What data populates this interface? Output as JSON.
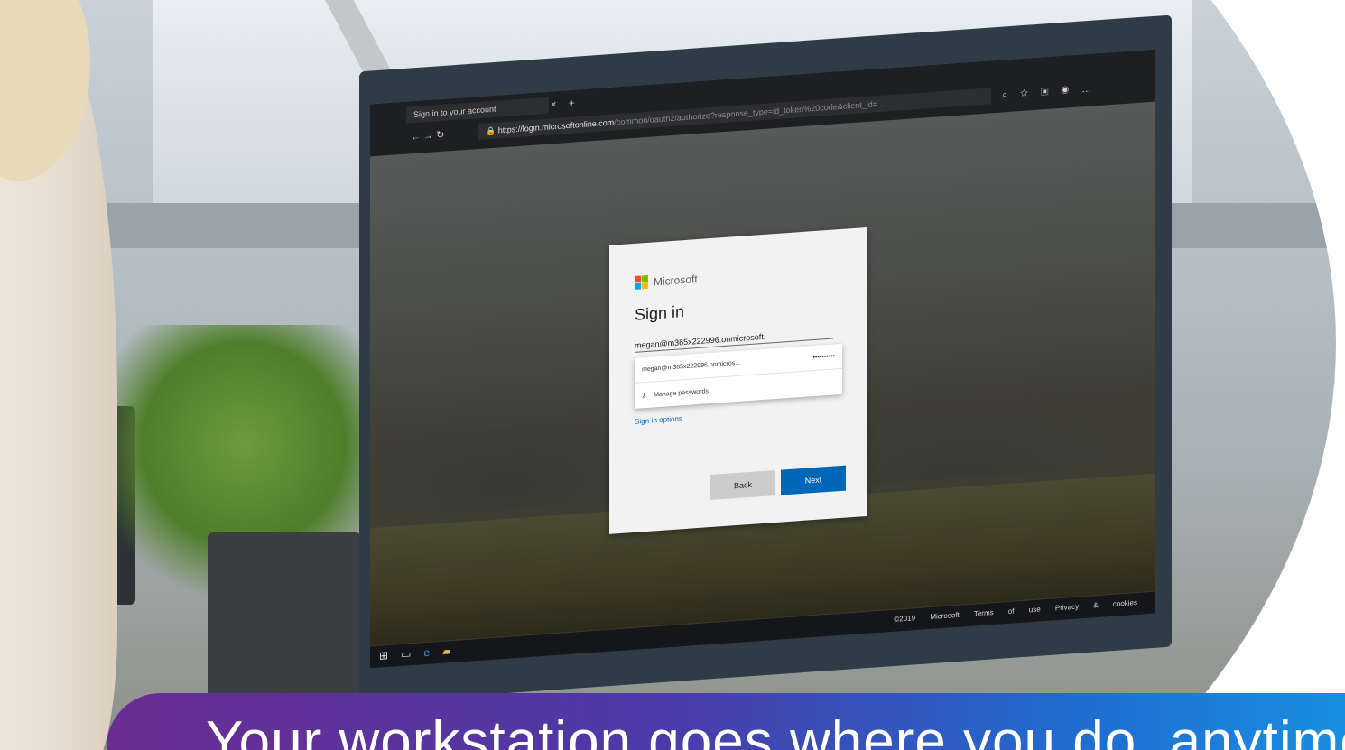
{
  "browser": {
    "tab_title": "Sign in to your account",
    "tab_close": "×",
    "tab_new": "+",
    "url_host": "https://login.microsoftonline.com",
    "url_path": "/common/oauth2/authorize?response_type=id_token%20code&client_id=..."
  },
  "signin": {
    "brand": "Microsoft",
    "title": "Sign in",
    "email_value": "megan@m365x222996.onmicrosoft.",
    "autofill_account": "megan@m365x222996.onmicros...",
    "autofill_password": "••••••••••",
    "manage_passwords": "Manage passwords",
    "options_link": "Sign-in options",
    "back_label": "Back",
    "next_label": "Next"
  },
  "taskbar": {
    "footer_links": "©2019 Microsoft Terms of use Privacy & cookies"
  },
  "banner": {
    "text": "Your workstation goes where you do, anytime"
  },
  "colors": {
    "next_button": "#0067b8",
    "banner_start": "#6a2c91",
    "banner_end": "#1a8fe0"
  }
}
